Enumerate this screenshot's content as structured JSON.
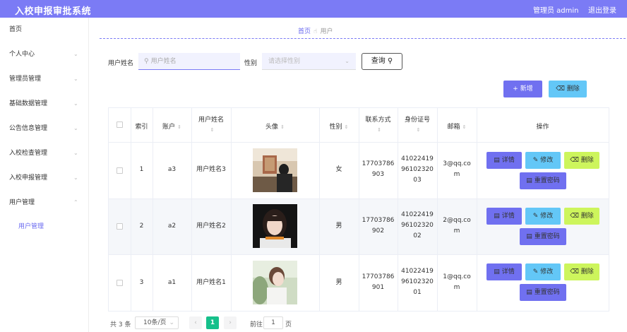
{
  "header": {
    "title": "入校申报审批系统",
    "admin_label": "管理员 admin",
    "logout_label": "退出登录"
  },
  "sidebar": {
    "items": [
      {
        "label": "首页",
        "expandable": false
      },
      {
        "label": "个人中心",
        "expandable": true
      },
      {
        "label": "管理员管理",
        "expandable": true
      },
      {
        "label": "基础数据管理",
        "expandable": true
      },
      {
        "label": "公告信息管理",
        "expandable": true
      },
      {
        "label": "入校检查管理",
        "expandable": true
      },
      {
        "label": "入校申报管理",
        "expandable": true
      },
      {
        "label": "用户管理",
        "expandable": true,
        "expanded": true
      }
    ],
    "sub_items": [
      {
        "label": "用户管理",
        "active": true
      }
    ]
  },
  "breadcrumb": {
    "home": "首页",
    "current": "用户"
  },
  "search": {
    "username_label": "用户姓名",
    "username_placeholder": "用户姓名",
    "gender_label": "性别",
    "gender_placeholder": "请选择性别",
    "query_label": "查询"
  },
  "toolbar": {
    "add_label": "新增",
    "delete_label": "删除"
  },
  "table": {
    "columns": [
      "索引",
      "账户",
      "用户姓名",
      "头像",
      "性别",
      "联系方式",
      "身份证号",
      "邮箱",
      "操作"
    ],
    "rows": [
      {
        "index": "1",
        "account": "a3",
        "name": "用户姓名3",
        "gender": "女",
        "phone": [
          "17703786",
          "903"
        ],
        "idcard": [
          "41022419",
          "96102320",
          "03"
        ],
        "email": [
          "3@qq.co",
          "m"
        ]
      },
      {
        "index": "2",
        "account": "a2",
        "name": "用户姓名2",
        "gender": "男",
        "phone": [
          "17703786",
          "902"
        ],
        "idcard": [
          "41022419",
          "96102320",
          "02"
        ],
        "email": [
          "2@qq.co",
          "m"
        ]
      },
      {
        "index": "3",
        "account": "a1",
        "name": "用户姓名1",
        "gender": "男",
        "phone": [
          "17703786",
          "901"
        ],
        "idcard": [
          "41022419",
          "96102320",
          "01"
        ],
        "email": [
          "1@qq.co",
          "m"
        ]
      }
    ],
    "actions": {
      "detail": "详情",
      "edit": "修改",
      "delete": "删除",
      "reset": "重置密码"
    }
  },
  "pagination": {
    "total": "共 3 条",
    "page_size": "10条/页",
    "current": "1",
    "goto_label": "前往",
    "goto_value": "1",
    "page_unit": "页"
  },
  "colors": {
    "accent": "#7b7bf5",
    "info": "#63c7f7",
    "lime": "#cdf55c",
    "page_active": "#16c08b"
  }
}
